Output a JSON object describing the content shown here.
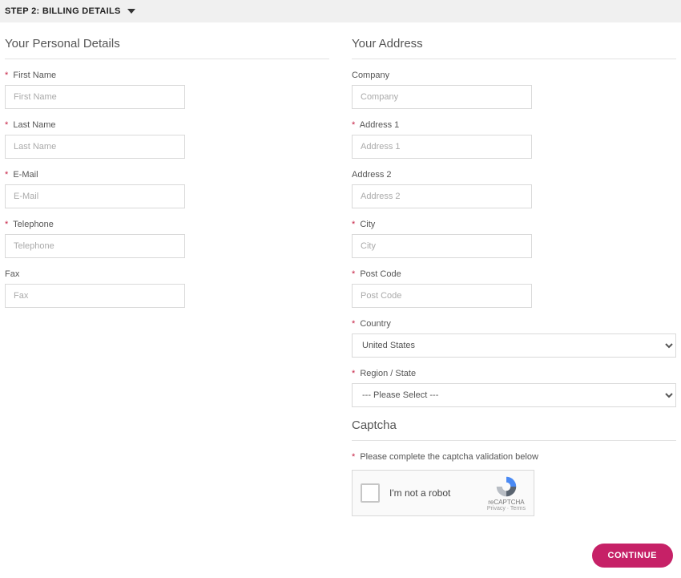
{
  "step": {
    "title": "STEP 2: BILLING DETAILS"
  },
  "sections": {
    "personal": {
      "title": "Your Personal Details"
    },
    "address": {
      "title": "Your Address"
    },
    "captcha": {
      "title": "Captcha"
    }
  },
  "personal": {
    "first_name": {
      "label": "First Name",
      "placeholder": "First Name",
      "required": true
    },
    "last_name": {
      "label": "Last Name",
      "placeholder": "Last Name",
      "required": true
    },
    "email": {
      "label": "E-Mail",
      "placeholder": "E-Mail",
      "required": true
    },
    "telephone": {
      "label": "Telephone",
      "placeholder": "Telephone",
      "required": true
    },
    "fax": {
      "label": "Fax",
      "placeholder": "Fax",
      "required": false
    }
  },
  "address": {
    "company": {
      "label": "Company",
      "placeholder": "Company",
      "required": false
    },
    "address1": {
      "label": "Address 1",
      "placeholder": "Address 1",
      "required": true
    },
    "address2": {
      "label": "Address 2",
      "placeholder": "Address 2",
      "required": false
    },
    "city": {
      "label": "City",
      "placeholder": "City",
      "required": true
    },
    "postcode": {
      "label": "Post Code",
      "placeholder": "Post Code",
      "required": true
    },
    "country": {
      "label": "Country",
      "selected": "United States",
      "required": true
    },
    "region": {
      "label": "Region / State",
      "selected": "--- Please Select ---",
      "required": true
    }
  },
  "captcha": {
    "label": "Please complete the captcha validation below",
    "checkbox_text": "I'm not a robot",
    "brand": "reCAPTCHA",
    "links": "Privacy · Terms"
  },
  "buttons": {
    "continue": "CONTINUE"
  },
  "markers": {
    "required": "*"
  }
}
